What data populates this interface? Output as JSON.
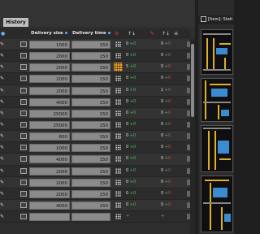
{
  "tab": {
    "label": "History"
  },
  "columns": {
    "delivery_size": "Delivery size",
    "delivery_time": "Delivery time"
  },
  "header_icons": [
    "settings-icon",
    "grid-icon",
    "arrows-icon",
    "trash-icon",
    "skull-icon"
  ],
  "rows": [
    {
      "size": "1000",
      "time": "150",
      "a": "0",
      "b": "0",
      "c": "0",
      "d": "0",
      "active": false
    },
    {
      "size": "2000",
      "time": "150",
      "a": "0",
      "b": "0",
      "c": "0",
      "d": "0",
      "active": false
    },
    {
      "size": "2000",
      "time": "150",
      "a": "5",
      "b": "0",
      "c": "0",
      "d": "0",
      "active": true
    },
    {
      "size": "2000",
      "time": "150",
      "a": "0",
      "b": "0",
      "c": "0",
      "d": "0",
      "active": false
    },
    {
      "size": "2000",
      "time": "150",
      "a": "0",
      "b": "0",
      "c": "1",
      "d": "0",
      "active": false
    },
    {
      "size": "4000",
      "time": "150",
      "a": "0",
      "b": "0",
      "c": "0",
      "d": "0",
      "active": false
    },
    {
      "size": "25000",
      "time": "150",
      "a": "0",
      "b": "0",
      "c": "0",
      "d": "0",
      "active": false
    },
    {
      "size": "25000",
      "time": "150",
      "a": "0",
      "b": "0",
      "c": "0",
      "d": "0",
      "active": false
    },
    {
      "size": "800",
      "time": "150",
      "a": "0",
      "b": "0",
      "c": "0",
      "d": "0",
      "active": false
    },
    {
      "size": "1000",
      "time": "150",
      "a": "0",
      "b": "0",
      "c": "0",
      "d": "0",
      "active": false
    },
    {
      "size": "4000",
      "time": "150",
      "a": "0",
      "b": "0",
      "c": "0",
      "d": "0",
      "active": false
    },
    {
      "size": "2000",
      "time": "150",
      "a": "0",
      "b": "0",
      "c": "0",
      "d": "0",
      "active": false
    },
    {
      "size": "2000",
      "time": "150",
      "a": "0",
      "b": "0",
      "c": "0",
      "d": "0",
      "active": false
    },
    {
      "size": "2000",
      "time": "150",
      "a": "0",
      "b": "0",
      "c": "0",
      "d": "0",
      "active": false
    },
    {
      "size": "4000",
      "time": "150",
      "a": "0",
      "b": "0",
      "c": "0",
      "d": "0",
      "active": false
    },
    {
      "size": "",
      "time": "",
      "a": "",
      "b": "",
      "c": "",
      "d": "",
      "active": false
    }
  ],
  "right_panel": {
    "title": "[Item]: Stati"
  },
  "colors": {
    "accent": "#f0a020",
    "green": "#49c35a",
    "red": "#e04848",
    "dot": "#6aaee8"
  }
}
